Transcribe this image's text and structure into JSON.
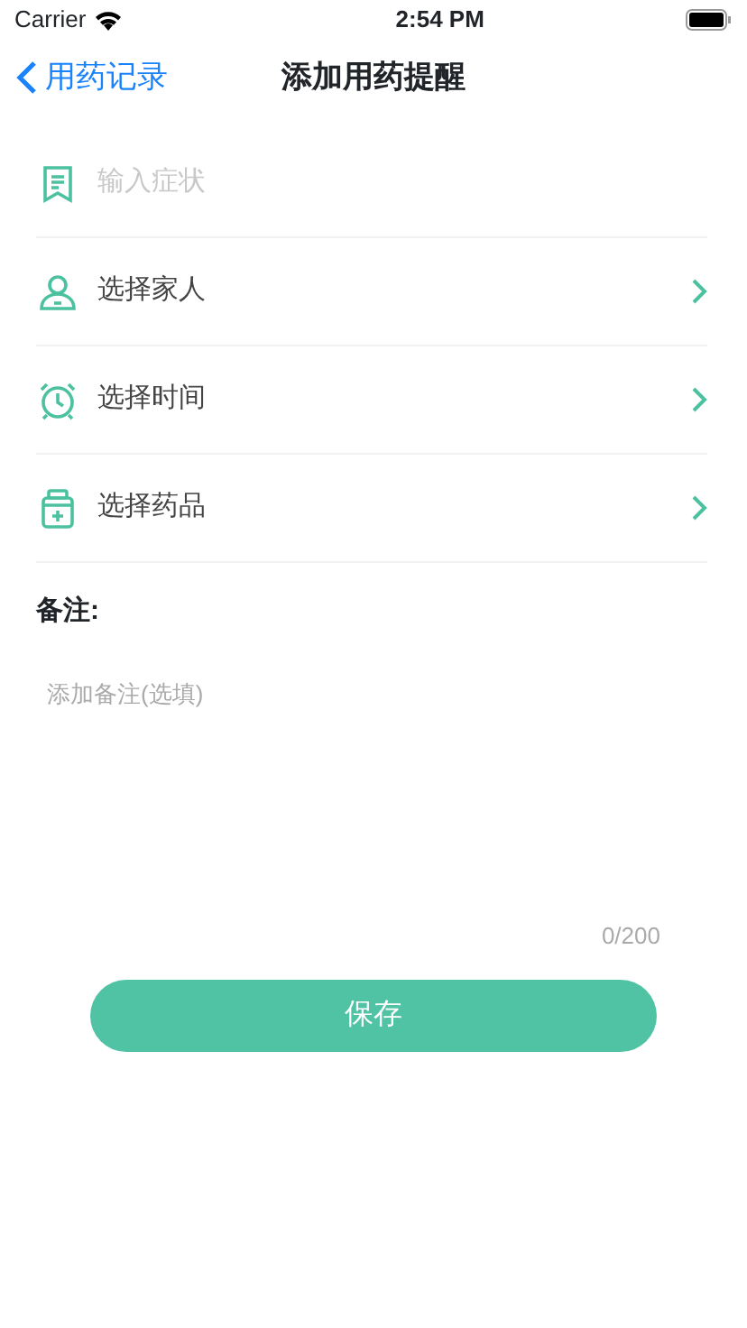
{
  "status_bar": {
    "carrier": "Carrier",
    "time": "2:54 PM"
  },
  "nav": {
    "back": "用药记录",
    "title": "添加用药提醒"
  },
  "rows": [
    {
      "kind": "input",
      "placeholder": "输入症状"
    },
    {
      "kind": "select",
      "label": "选择家人"
    },
    {
      "kind": "select",
      "label": "选择时间"
    },
    {
      "kind": "select",
      "label": "选择药品"
    }
  ],
  "notes": {
    "label": "备注:",
    "placeholder": "添加备注(选填)",
    "counter": "0/200"
  },
  "save_button": "保存"
}
